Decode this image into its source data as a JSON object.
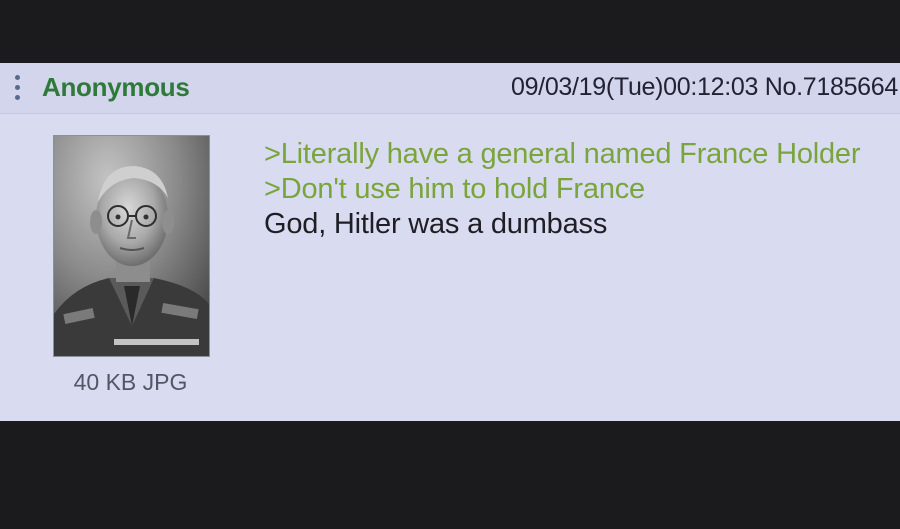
{
  "post": {
    "name": "Anonymous",
    "datetime": "09/03/19(Tue)00:12:03",
    "post_number": "No.7185664",
    "file_info": "40 KB JPG",
    "icons": {
      "menu": "more-vertical-icon"
    },
    "colors": {
      "name": "#2f7a3a",
      "greentext": "#7aa43c",
      "background": "#d9dcf1"
    },
    "lines": [
      {
        "type": "greentext",
        "text": ">Literally have a general named France Holder"
      },
      {
        "type": "greentext",
        "text": ">Don't use him to hold France"
      },
      {
        "type": "text",
        "text": "God, Hitler was a dumbass"
      }
    ]
  }
}
